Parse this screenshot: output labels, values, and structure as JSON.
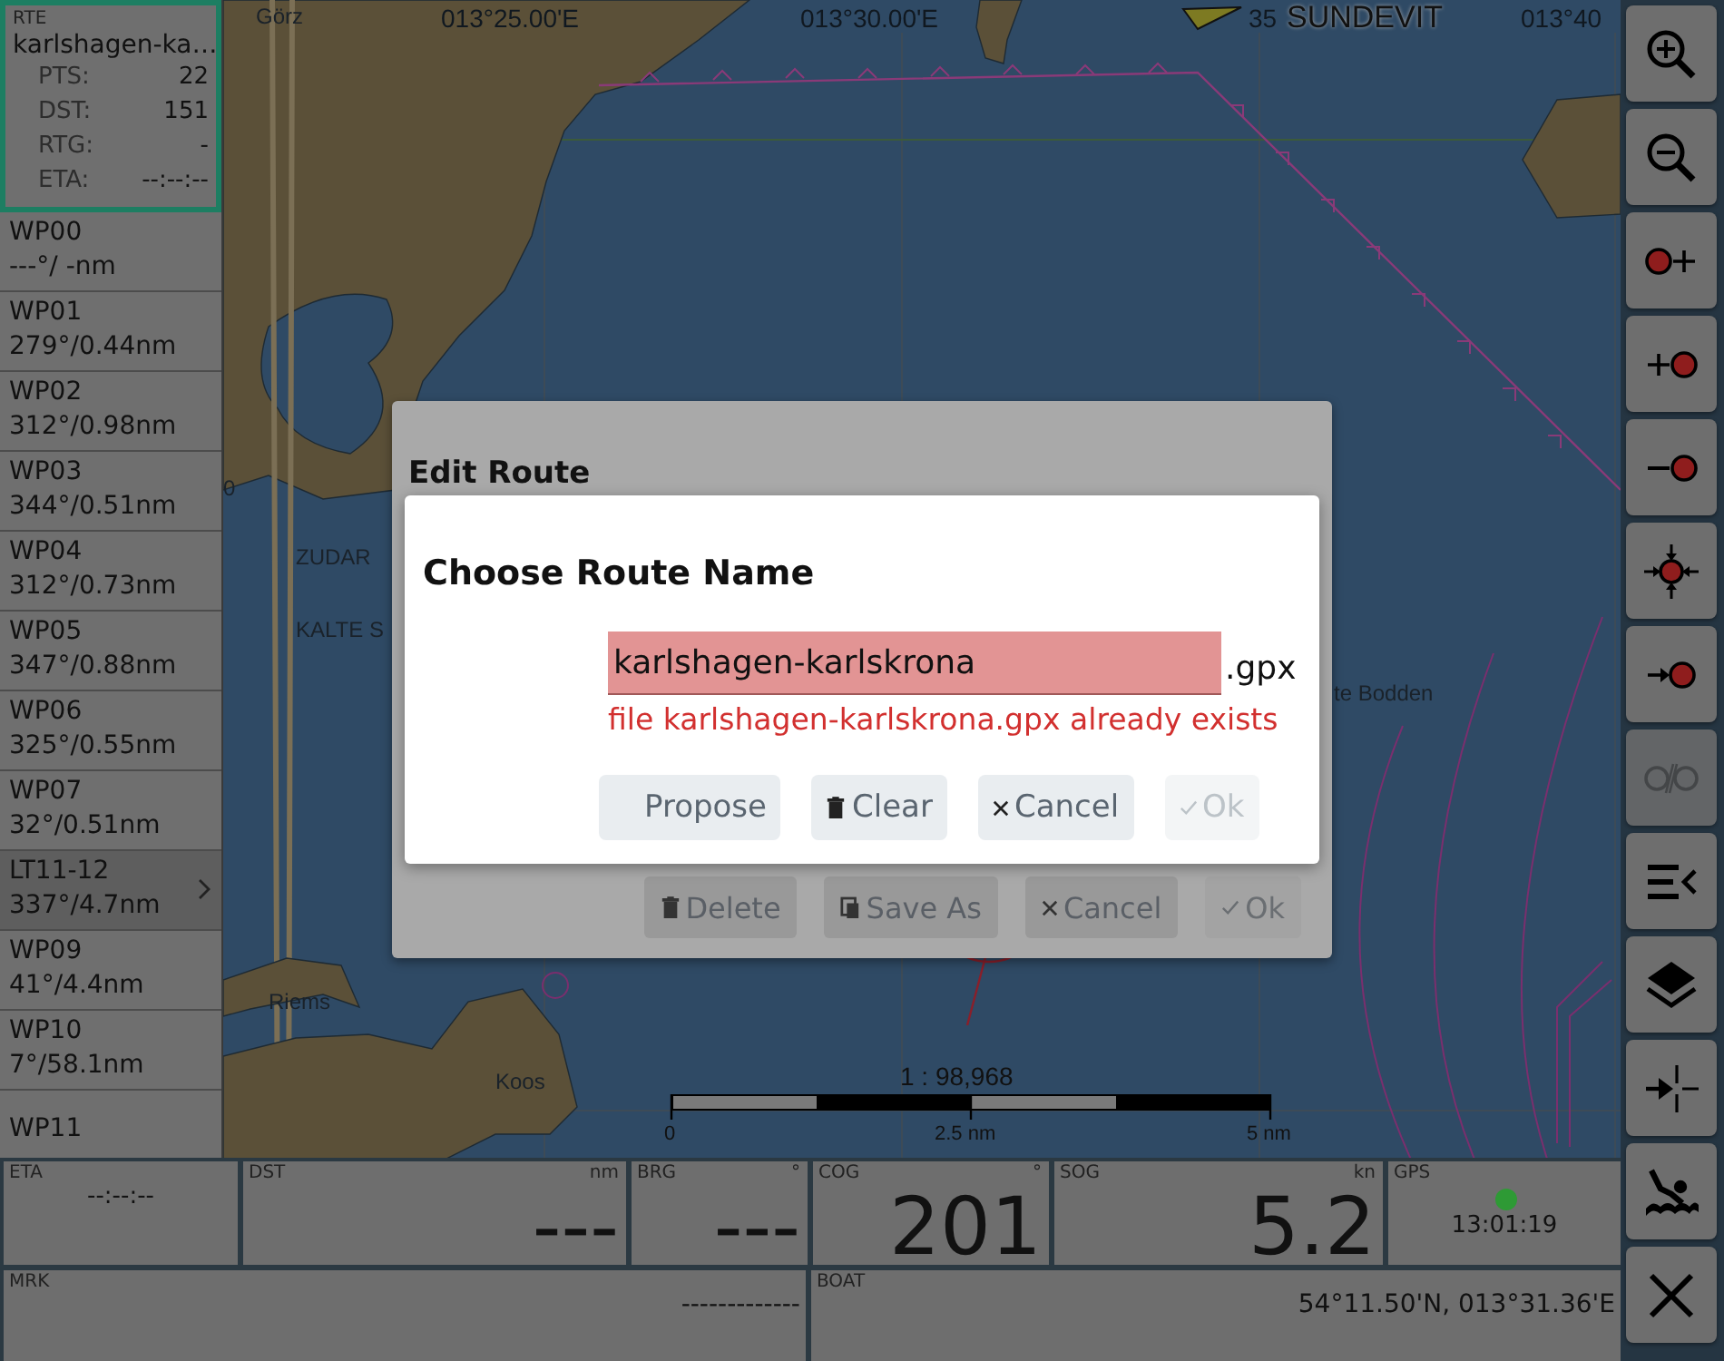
{
  "route_info": {
    "label": "RTE",
    "name": "karlshagen-ka…",
    "fields": [
      {
        "label": "PTS:",
        "value": "22"
      },
      {
        "label": "DST:",
        "value": "151"
      },
      {
        "label": "RTG:",
        "value": "-"
      },
      {
        "label": "ETA:",
        "value": "--:--:--"
      }
    ]
  },
  "waypoints": [
    {
      "name": "WP00",
      "info": "---°/ -nm",
      "selected": false
    },
    {
      "name": "WP01",
      "info": "279°/0.44nm",
      "selected": false
    },
    {
      "name": "WP02",
      "info": "312°/0.98nm",
      "selected": false
    },
    {
      "name": "WP03",
      "info": "344°/0.51nm",
      "selected": false
    },
    {
      "name": "WP04",
      "info": "312°/0.73nm",
      "selected": false
    },
    {
      "name": "WP05",
      "info": "347°/0.88nm",
      "selected": false
    },
    {
      "name": "WP06",
      "info": "325°/0.55nm",
      "selected": false
    },
    {
      "name": "WP07",
      "info": "32°/0.51nm",
      "selected": false
    },
    {
      "name": "LT11-12",
      "info": "337°/4.7nm",
      "selected": true
    },
    {
      "name": "WP09",
      "info": "41°/4.4nm",
      "selected": false
    },
    {
      "name": "WP10",
      "info": "7°/58.1nm",
      "selected": false
    },
    {
      "name": "WP11",
      "selected": false
    }
  ],
  "map": {
    "labels": [
      {
        "text": "Görz",
        "kind": "place"
      },
      {
        "text": "013°25.00'E",
        "kind": "grid"
      },
      {
        "text": "013°30.00'E",
        "kind": "grid"
      },
      {
        "text": "35",
        "kind": "grid"
      },
      {
        "text": "013°40",
        "kind": "grid"
      },
      {
        "text": "0",
        "kind": "place"
      },
      {
        "text": "ZUDAR",
        "kind": "place"
      },
      {
        "text": "KALTE S",
        "kind": "place"
      },
      {
        "text": "te Bodden",
        "kind": "place"
      },
      {
        "text": "Riems",
        "kind": "place"
      },
      {
        "text": "Koos",
        "kind": "place"
      }
    ],
    "vessel": {
      "name": "SUNDEVIT"
    },
    "scale": {
      "ratio": "1 : 98,968",
      "ticks": [
        "0",
        "2.5 nm",
        "5 nm"
      ]
    }
  },
  "edit_dialog": {
    "title": "Edit Route",
    "buttons": [
      {
        "label": "Delete",
        "kind": "delete",
        "disabled": false
      },
      {
        "label": "Save As",
        "kind": "save-as",
        "disabled": false
      },
      {
        "label": "Cancel",
        "kind": "cancel",
        "disabled": false
      },
      {
        "label": "Ok",
        "kind": "ok",
        "disabled": true
      }
    ]
  },
  "name_dialog": {
    "title": "Choose Route Name",
    "value": "karlshagen-karlskrona",
    "suffix": ".gpx",
    "error": "file karlshagen-karlskrona.gpx already exists",
    "buttons": [
      {
        "label": "Propose",
        "kind": "propose",
        "disabled": false
      },
      {
        "label": "Clear",
        "kind": "delete",
        "disabled": false
      },
      {
        "label": "Cancel",
        "kind": "cancel",
        "disabled": false
      },
      {
        "label": "Ok",
        "kind": "ok",
        "disabled": true
      }
    ]
  },
  "toolbar": [
    {
      "kind": "zoom-in",
      "disabled": false
    },
    {
      "kind": "zoom-out",
      "disabled": false
    },
    {
      "kind": "dot-plus",
      "disabled": false
    },
    {
      "kind": "plus-dot",
      "disabled": false
    },
    {
      "kind": "minus-dot",
      "disabled": false
    },
    {
      "kind": "center",
      "disabled": false
    },
    {
      "kind": "arrow-dot",
      "disabled": false
    },
    {
      "kind": "unlink",
      "disabled": true
    },
    {
      "kind": "list",
      "disabled": false
    },
    {
      "kind": "layers",
      "disabled": false
    },
    {
      "kind": "arrow-cross",
      "disabled": false
    },
    {
      "kind": "swimmer",
      "disabled": false
    },
    {
      "kind": "close",
      "disabled": false
    }
  ],
  "instruments": {
    "row_1": [
      {
        "kind": "small",
        "label": "ETA",
        "value": "--:--:--"
      },
      {
        "kind": "large",
        "label": "DST",
        "unit": "nm",
        "value": "---"
      },
      {
        "kind": "large",
        "label": "BRG",
        "unit": "°",
        "value": "---"
      },
      {
        "kind": "large",
        "label": "COG",
        "unit": "°",
        "value": "201"
      },
      {
        "kind": "large",
        "label": "SOG",
        "unit": "kn",
        "value": "5.2"
      },
      {
        "kind": "gps",
        "label": "GPS",
        "value": "13:01:19",
        "color": "#2e9a35"
      }
    ],
    "row_2": [
      {
        "kind": "right",
        "label": "MRK",
        "value": "-------------"
      },
      {
        "kind": "right",
        "label": "BOAT",
        "value": "54°11.50'N, 013°31.36'E"
      }
    ]
  }
}
